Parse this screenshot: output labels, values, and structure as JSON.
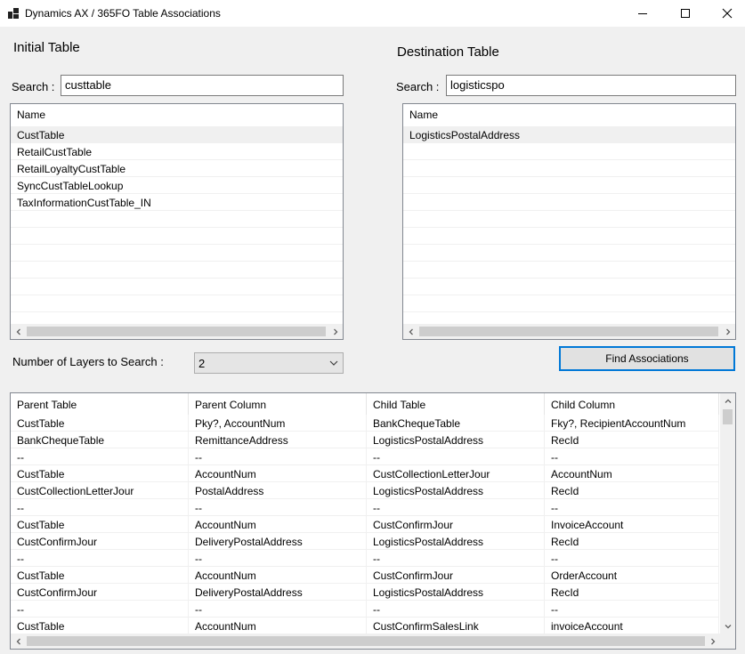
{
  "window": {
    "title": "Dynamics AX / 365FO Table Associations"
  },
  "initial": {
    "heading": "Initial Table",
    "search_label": "Search :",
    "search_value": "custtable",
    "column_header": "Name",
    "items": [
      "CustTable",
      "RetailCustTable",
      "RetailLoyaltyCustTable",
      "SyncCustTableLookup",
      "TaxInformationCustTable_IN"
    ],
    "selected_index": 0
  },
  "destination": {
    "heading": "Destination Table",
    "search_label": "Search :",
    "search_value": "logisticspo",
    "column_header": "Name",
    "items": [
      "LogisticsPostalAddress"
    ],
    "selected_index": 0
  },
  "layers": {
    "label": "Number of Layers to Search :",
    "value": "2"
  },
  "find_button_label": "Find Associations",
  "results": {
    "headers": [
      "Parent Table",
      "Parent Column",
      "Child Table",
      "Child Column"
    ],
    "rows": [
      [
        "CustTable",
        "Pky?, AccountNum",
        "BankChequeTable",
        "Fky?, RecipientAccountNum"
      ],
      [
        "BankChequeTable",
        "RemittanceAddress",
        "LogisticsPostalAddress",
        "RecId"
      ],
      [
        "--",
        "--",
        "--",
        "--"
      ],
      [
        "CustTable",
        "AccountNum",
        "CustCollectionLetterJour",
        "AccountNum"
      ],
      [
        "CustCollectionLetterJour",
        "PostalAddress",
        "LogisticsPostalAddress",
        "RecId"
      ],
      [
        "--",
        "--",
        "--",
        "--"
      ],
      [
        "CustTable",
        "AccountNum",
        "CustConfirmJour",
        "InvoiceAccount"
      ],
      [
        "CustConfirmJour",
        "DeliveryPostalAddress",
        "LogisticsPostalAddress",
        "RecId"
      ],
      [
        "--",
        "--",
        "--",
        "--"
      ],
      [
        "CustTable",
        "AccountNum",
        "CustConfirmJour",
        "OrderAccount"
      ],
      [
        "CustConfirmJour",
        "DeliveryPostalAddress",
        "LogisticsPostalAddress",
        "RecId"
      ],
      [
        "--",
        "--",
        "--",
        "--"
      ],
      [
        "CustTable",
        "AccountNum",
        "CustConfirmSalesLink",
        "invoiceAccount"
      ]
    ]
  },
  "icons": [
    "app-icon",
    "minimize-icon",
    "maximize-icon",
    "close-icon",
    "chevron-left-icon",
    "chevron-right-icon",
    "chevron-up-icon",
    "chevron-down-icon"
  ],
  "colors": {
    "window_bg": "#f0f0f0",
    "button_border": "#0078d7",
    "selection": "#f0f0f0"
  }
}
